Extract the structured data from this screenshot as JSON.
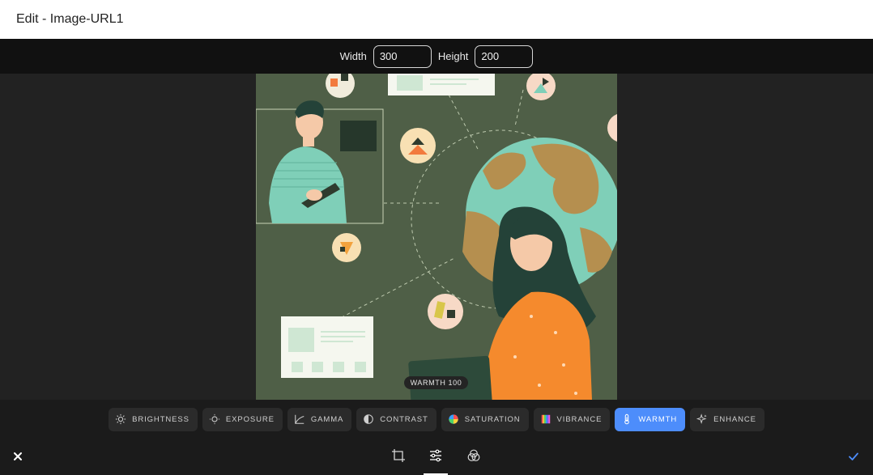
{
  "window": {
    "title": "Edit - Image-URL1"
  },
  "dimensions": {
    "width_label": "Width",
    "width_value": "300",
    "height_label": "Height",
    "height_value": "200"
  },
  "preview": {
    "badge": "WARMTH 100"
  },
  "filters": [
    {
      "label": "BRIGHTNESS",
      "icon": "brightness-icon",
      "active": false
    },
    {
      "label": "EXPOSURE",
      "icon": "exposure-icon",
      "active": false
    },
    {
      "label": "GAMMA",
      "icon": "gamma-icon",
      "active": false
    },
    {
      "label": "CONTRAST",
      "icon": "contrast-icon",
      "active": false
    },
    {
      "label": "SATURATION",
      "icon": "saturation-icon",
      "active": false
    },
    {
      "label": "VIBRANCE",
      "icon": "vibrance-icon",
      "active": false
    },
    {
      "label": "WARMTH",
      "icon": "thermometer-icon",
      "active": true
    },
    {
      "label": "ENHANCE",
      "icon": "sparkle-icon",
      "active": false
    }
  ],
  "tools": [
    {
      "icon": "crop-icon",
      "active": false
    },
    {
      "icon": "sliders-icon",
      "active": true
    },
    {
      "icon": "filters-icon",
      "active": false
    }
  ],
  "colors": {
    "accent": "#4d8dfb",
    "background": "#1b1b1b",
    "image_bg": "#4f5f47"
  }
}
